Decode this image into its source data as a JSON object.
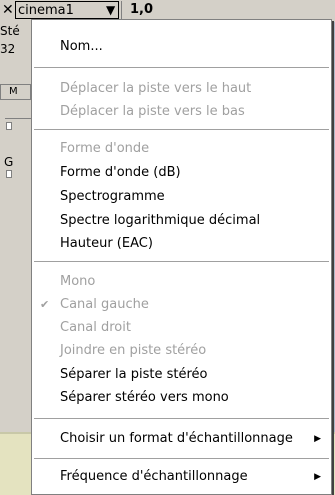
{
  "track": {
    "close_glyph": "✕",
    "name": "cinema1",
    "rate": "1,0",
    "side_text": [
      "Sté",
      "32"
    ],
    "mute_label": "M",
    "gain_label": "G"
  },
  "menu": {
    "items": [
      {
        "label": "Nom...",
        "disabled": false
      },
      {
        "label": "Déplacer la piste vers le haut",
        "disabled": true
      },
      {
        "label": "Déplacer la piste vers le bas",
        "disabled": true
      },
      {
        "label": "Forme d'onde",
        "disabled": true
      },
      {
        "label": "Forme d'onde (dB)",
        "disabled": false
      },
      {
        "label": "Spectrogramme",
        "disabled": false
      },
      {
        "label": "Spectre logarithmique décimal",
        "disabled": false
      },
      {
        "label": "Hauteur (EAC)",
        "disabled": false
      },
      {
        "label": "Mono",
        "disabled": true
      },
      {
        "label": "Canal gauche",
        "disabled": true,
        "checked": true
      },
      {
        "label": "Canal droit",
        "disabled": true
      },
      {
        "label": "Joindre en piste stéréo",
        "disabled": true
      },
      {
        "label": "Séparer la piste stéréo",
        "disabled": false
      },
      {
        "label": "Séparer stéréo vers mono",
        "disabled": false
      },
      {
        "label": "Choisir un format d'échantillonnage",
        "disabled": false,
        "submenu": true
      },
      {
        "label": "Fréquence d'échantillonnage",
        "disabled": false,
        "submenu": true
      }
    ],
    "check_glyph": "✔",
    "submenu_glyph": "▶"
  }
}
